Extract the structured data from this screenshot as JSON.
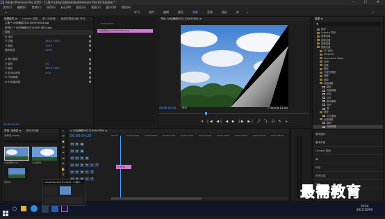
{
  "window": {
    "title": "Adobe Premiere Pro 2020 - C:\\用户\\Libby\\文档\\Adobe\\Premiere Pro\\14.0\\未命名 *"
  },
  "menu": [
    "文件(F)",
    "编辑(E)",
    "剪辑(C)",
    "序列(S)",
    "标记(M)",
    "图形(G)",
    "视图(V)",
    "窗口(W)",
    "帮助(H)"
  ],
  "workspaces": {
    "items": [
      "学习",
      "组件",
      "编辑",
      "颜色",
      "效果",
      "音频",
      "图形",
      "库"
    ],
    "active_index": 4
  },
  "effect_controls": {
    "tabs": [
      "效果控件 ≡",
      "Lumetri 范围",
      "源: (无剪辑)",
      "音频剪辑混合器: 序列"
    ],
    "source": "主要 * 00后悔用2021100915824.jpg",
    "sequence": "序列01 * 00后悔用2021100915824.jpg",
    "rows": [
      {
        "label": "视频",
        "value": "",
        "header": true
      },
      {
        "label": "fx 运动",
        "value": ""
      },
      {
        "label": "Ö 位置",
        "value": "360.0  240.0"
      },
      {
        "label": "Ö 缩放",
        "value": "100.0"
      },
      {
        "label": "缩放宽度",
        "value": "100.0"
      },
      {
        "label": "",
        "value": ""
      },
      {
        "label": "☑ 等比缩放",
        "value": ""
      },
      {
        "label": "Ö 旋转",
        "value": "0.0"
      },
      {
        "label": "Ö 锚点",
        "value": "960.0  540.0"
      },
      {
        "label": "Ö 防闪烁滤镜",
        "value": "0.00"
      },
      {
        "label": "fx 不透明度",
        "value": ""
      },
      {
        "label": "fx 时间重映射",
        "value": ""
      }
    ],
    "timecode": "00:00:04:20",
    "clip_ruler": "00:00:05:00",
    "clip_name": "00后悔用2021100915824.jpg"
  },
  "program": {
    "tab": "节目: 00后悔用2021100915824 ≡",
    "timecode": "00:00:04:20",
    "fit": "适合",
    "fraction": "1/2",
    "duration": "00:00:12:00",
    "controls": "▾  |◀  ◀|  ◀  ▶  |▶  ▶|  ⤴  ⤵  ⊡  ✎  +"
  },
  "effects_panel": {
    "title": "效果 ≡",
    "search": "🔍",
    "rows": [
      {
        "label": "预设",
        "kind": "folder",
        "indent": 1,
        "selected": false
      },
      {
        "label": "Lumetri 预设",
        "kind": "folder",
        "indent": 1,
        "selected": false
      },
      {
        "label": "音频效果",
        "kind": "folder",
        "indent": 1,
        "selected": false
      },
      {
        "label": "音频过渡",
        "kind": "folder",
        "indent": 1,
        "selected": false
      },
      {
        "label": "视频效果",
        "kind": "folder",
        "indent": 1,
        "selected": false
      },
      {
        "label": "视频过渡",
        "kind": "folder",
        "indent": 1,
        "selected": false
      },
      {
        "label": "3D 运动",
        "kind": "folder",
        "indent": 2,
        "selected": false
      },
      {
        "label": "Dissolve",
        "kind": "folder",
        "indent": 2,
        "selected": false
      },
      {
        "label": "Immersive Video",
        "kind": "folder",
        "indent": 2,
        "selected": false
      },
      {
        "label": "内滑",
        "kind": "folder",
        "indent": 2,
        "selected": false
      },
      {
        "label": "划像",
        "kind": "folder",
        "indent": 2,
        "selected": false
      },
      {
        "label": "擦除",
        "kind": "folder",
        "indent": 2,
        "selected": false
      },
      {
        "label": "沉浸式视频",
        "kind": "folder",
        "indent": 2,
        "selected": false
      },
      {
        "label": "溶解",
        "kind": "folder",
        "indent": 2,
        "selected": false
      },
      {
        "label": "缩放",
        "kind": "folder",
        "indent": 2,
        "selected": false
      },
      {
        "label": "页面剥落",
        "kind": "folder",
        "indent": 2,
        "selected": false
      },
      {
        "label": "翻页",
        "kind": "fx",
        "indent": 3,
        "selected": false
      },
      {
        "label": "页面剥落",
        "kind": "fx",
        "indent": 3,
        "selected": false
      },
      {
        "label": "划出",
        "kind": "fx",
        "indent": 3,
        "selected": false
      },
      {
        "label": "交叉",
        "kind": "fx",
        "indent": 3,
        "selected": false
      },
      {
        "label": "带状擦除",
        "kind": "fx",
        "indent": 3,
        "selected": false
      },
      {
        "label": "拆分",
        "kind": "fx",
        "indent": 3,
        "selected": false
      },
      {
        "label": "推",
        "kind": "fx",
        "indent": 3,
        "selected": false
      },
      {
        "label": "缩放",
        "kind": "folder",
        "indent": 2,
        "selected": false
      },
      {
        "label": "交叉缩放",
        "kind": "fx",
        "indent": 3,
        "selected": false
      },
      {
        "label": "页面剥落",
        "kind": "folder",
        "indent": 2,
        "selected": false
      },
      {
        "label": "翻页",
        "kind": "fx",
        "indent": 3,
        "selected": false
      },
      {
        "label": "页面剥落",
        "kind": "fx",
        "indent": 3,
        "selected": true
      }
    ]
  },
  "essentials": {
    "items": [
      "基本图形",
      "基本声音",
      "Lumetri 颜色",
      "库",
      "标记",
      "历史记录",
      "信息"
    ]
  },
  "project": {
    "tabs": [
      "项目: 未命名 ≡",
      "媒体浏览器"
    ],
    "filename": "未命名.prproj",
    "items": [
      "00后悔用2021...",
      "00后悔用...",
      "序列01",
      ""
    ]
  },
  "tools": [
    "▸",
    "⇔",
    "◆",
    "⇹",
    "✂",
    "⇋",
    "✎",
    "✋",
    "T"
  ],
  "timeline": {
    "tab": "× 00后悔用2021100915824 ≡",
    "timecode": "00:00:04:20",
    "ruler": [
      "00:00",
      "00:00:04:00",
      "00:00:08:00",
      "00:00:12:00",
      "00:00:16:00",
      "00:00:20:00",
      "00:00:24:00",
      "00:00:28:00",
      "00:00:32:00",
      "00:00:36:00",
      "00:00:40:00"
    ],
    "tracks": [
      {
        "name": "V3",
        "btns": [
          "V3",
          "B",
          "◉"
        ]
      },
      {
        "name": "V2",
        "btns": [
          "V2",
          "B",
          "◉"
        ]
      },
      {
        "name": "V1",
        "btns": [
          "V1",
          "V1",
          "B",
          "◉"
        ]
      },
      {
        "name": "A1",
        "btns": [
          "A1",
          "A1",
          "B",
          "M",
          "S",
          "🎤"
        ]
      },
      {
        "name": "A2",
        "btns": [
          "A2",
          "B",
          "M",
          "S",
          "🎤"
        ]
      },
      {
        "name": "A3",
        "btns": [
          "A3",
          "B",
          "M",
          "S",
          "🎤"
        ]
      },
      {
        "name": "主声道",
        "btns": [
          "0.0"
        ]
      }
    ],
    "clip_label": "fx 00后"
  },
  "taskbar": {
    "preview_title": "Adobe Premiere Pro 2020 - C:\\用户...",
    "time": "19:24",
    "date": "2021/10/09"
  },
  "watermark": "最需教育",
  "colors": {
    "accent": "#4d9aff",
    "clip": "#d77ad7",
    "active_workspace": "#6fa8ff",
    "watermark": "#2a3fd0"
  }
}
